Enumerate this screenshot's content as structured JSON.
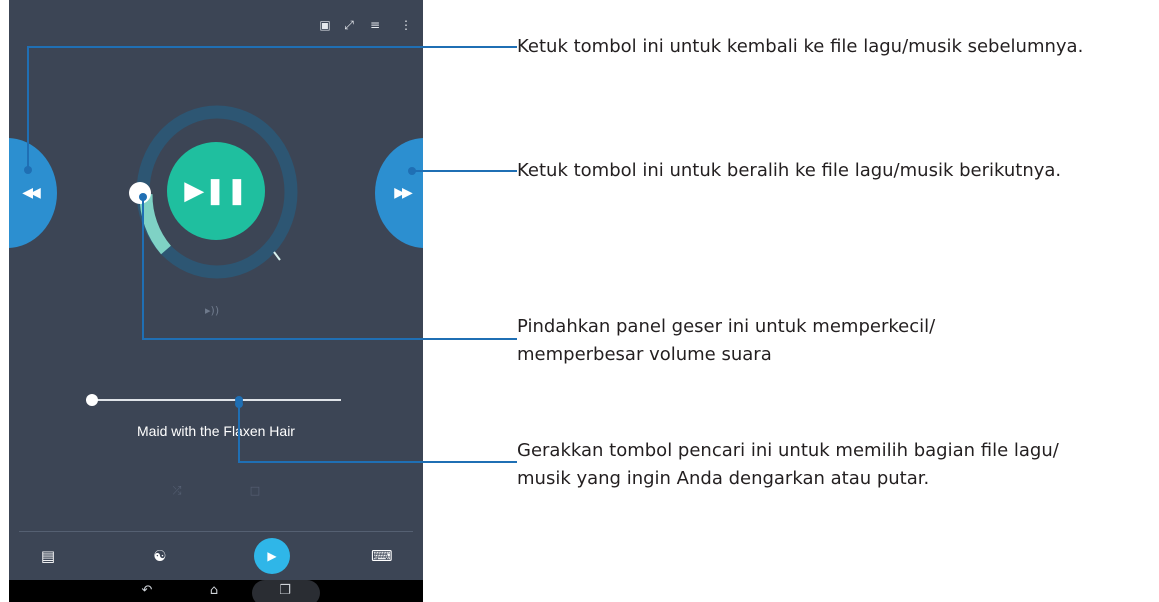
{
  "top_icons": [
    "mini-player-icon",
    "fullscreen-icon",
    "playlist-icon",
    "overflow-menu-icon"
  ],
  "player": {
    "song_title": "Maid with the Flaxen Hair",
    "prev_icon": "rewind-icon",
    "next_icon": "fast-forward-icon",
    "playpause_icon": "play-pause-icon",
    "volume_icon": "speaker-icon",
    "shuffle_icon": "shuffle-icon",
    "repeat_icon": "repeat-icon",
    "seek_position_fraction": 0.6,
    "colors": {
      "background": "#3c4555",
      "accent_blue": "#2c8fd0",
      "play_green": "#1fbf9f",
      "callout_line": "#1f6fb4"
    }
  },
  "bottom_bar": [
    "window-icon",
    "presentation-icon",
    "play-icon",
    "keyboard-icon"
  ],
  "nav_bar": [
    "back-icon",
    "home-icon",
    "recent-apps-icon"
  ],
  "callouts": [
    "Ketuk tombol ini untuk kembali ke file lagu/musik sebelumnya.",
    "Ketuk tombol ini untuk beralih ke file lagu/musik berikutnya.",
    "Pindahkan panel geser ini untuk memperkecil/",
    "memperbesar volume suara",
    "Gerakkan tombol pencari ini untuk memilih bagian file lagu/",
    "musik yang ingin Anda dengarkan atau putar."
  ]
}
